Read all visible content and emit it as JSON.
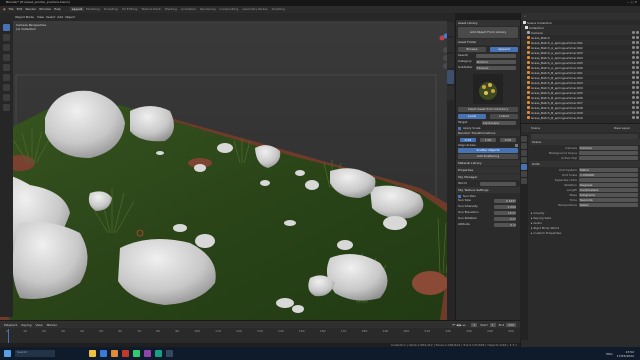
{
  "window": {
    "title": "Blender* [E:\\asset_pointer_practice.blend]"
  },
  "menu": [
    "File",
    "Edit",
    "Render",
    "Window",
    "Help"
  ],
  "workspaces": [
    "Layout",
    "Modeling",
    "Sculpting",
    "UV Editing",
    "Texture Paint",
    "Shading",
    "Animation",
    "Rendering",
    "Compositing",
    "Geometry Nodes",
    "Scripting"
  ],
  "viewport": {
    "camera_label": "Camera Perspective",
    "collection_label": "(1) Collection",
    "mode": "Object Mode",
    "header_items": [
      "View",
      "Select",
      "Add",
      "Object"
    ],
    "gizmo": {
      "x_label": "X",
      "y_label": "Y",
      "z_label": "Z"
    }
  },
  "npanel": {
    "tabs": [
      "Item",
      "Tool",
      "View",
      "Asset Library",
      "Sky Manager",
      "Edit"
    ],
    "asset_library_title": "Asset Library",
    "add_object_button": "Add Object From Library",
    "asset_folder_title": "Asset Folder",
    "toggle_buttons": [
      "Browse",
      "Append"
    ],
    "search_label": "Search",
    "category_label": "Category",
    "category_value": "Botanic",
    "subfolder_label": "Subfolder",
    "subfolder_value": "Flowers",
    "insert_button": "Insert Asset from Directory",
    "mode_buttons": [
      "Local",
      "Linked"
    ],
    "origin_label": "Target",
    "origin_value": "Landscape",
    "apply_checkbox": "Apply Scale",
    "random_section": "Random Transformations",
    "size_label": "Size",
    "size_values": [
      "0.25",
      "1.00",
      "0.00"
    ],
    "scale_axis_label": "Scale",
    "align_label": "Align Z-Axis",
    "scatter_button": "Scatter Objects",
    "scatter_button2": "Add Scattering",
    "material_library": "Material Library",
    "properties_section": "Properties",
    "sky_manager": "Sky Manager",
    "world_label": "World",
    "sky_texture_settings": "Sky Texture Settings",
    "sun_disc": "Sun Disc",
    "sun_rows": [
      {
        "label": "Sun Size",
        "value": "0.545°"
      },
      {
        "label": "Sun Intensity",
        "value": "1.000"
      },
      {
        "label": "Sun Elevation",
        "value": "15.0°"
      },
      {
        "label": "Sun Rotation",
        "value": "0.0°"
      },
      {
        "label": "Altitude",
        "value": "0 m"
      }
    ]
  },
  "timeline": {
    "menus": [
      "Playback",
      "Keying",
      "View",
      "Marker"
    ],
    "current_frame": "1",
    "start_label": "Start",
    "start": "1",
    "end_label": "End",
    "end": "250",
    "ticks": [
      "0",
      "10",
      "20",
      "30",
      "40",
      "50",
      "60",
      "70",
      "80",
      "90",
      "100",
      "110",
      "120",
      "130",
      "140",
      "150",
      "160",
      "170",
      "180",
      "190",
      "200",
      "210",
      "220",
      "230",
      "240",
      "250"
    ]
  },
  "statusbar": {
    "right_text": "Collection | Verts:1,084,312 | Faces:1,066,814 | Tris:2,133,628 | Objects:0/46 | 3.3.1"
  },
  "outliner": {
    "header": "Scene Collection",
    "collection": "Collection",
    "items": [
      "Camera",
      "Grass_Batch",
      "Grass_Batch_A_springsummer.001",
      "Grass_Batch_A_springsummer.002",
      "Grass_Batch_A_springsummer.003",
      "Grass_Batch_A_springsummer.004",
      "Grass_Batch_A_springsummer.005",
      "Grass_Batch_A_springsummer.006",
      "Grass_Batch_B_springsummer.001",
      "Grass_Batch_B_springsummer.002",
      "Grass_Batch_B_springsummer.003",
      "Grass_Batch_B_springsummer.004",
      "Grass_Batch_B_springsummer.005",
      "Grass_Batch_B_springsummer.006",
      "Grass_Batch_B_springsummer.007",
      "Grass_Batch_B_springsummer.008",
      "Grass_Batch_B_springsummer.009",
      "Grass_Batch_B_springsummer.010"
    ]
  },
  "properties": {
    "header_left": "Scene",
    "header_right": "View Layer",
    "scene_section": "Scene",
    "rows1": [
      {
        "label": "Camera",
        "value": "Camera"
      },
      {
        "label": "Background Scene",
        "value": ""
      },
      {
        "label": "Active Clip",
        "value": ""
      }
    ],
    "units_section": "Units",
    "rows2": [
      {
        "label": "Unit System",
        "value": "Metric"
      },
      {
        "label": "Unit Scale",
        "value": "1.000000"
      },
      {
        "label": "Separate Units",
        "value": ""
      },
      {
        "label": "Rotation",
        "value": "Degrees"
      },
      {
        "label": "Length",
        "value": "Centimeters"
      },
      {
        "label": "Mass",
        "value": "Kilograms"
      },
      {
        "label": "Time",
        "value": "Seconds"
      },
      {
        "label": "Temperature",
        "value": "Kelvin"
      }
    ],
    "collapsed": [
      "Gravity",
      "Keying Sets",
      "Audio",
      "Rigid Body World",
      "Custom Properties"
    ]
  },
  "taskbar": {
    "search_placeholder": "Search",
    "clock_time": "13:52",
    "clock_date": "17/05/2022",
    "lang": "ENG"
  },
  "colors": {
    "accent": "#4772b3",
    "orange": "#e08a3a",
    "grass_dark": "#2e4a1c",
    "soil": "#8a4a35"
  }
}
